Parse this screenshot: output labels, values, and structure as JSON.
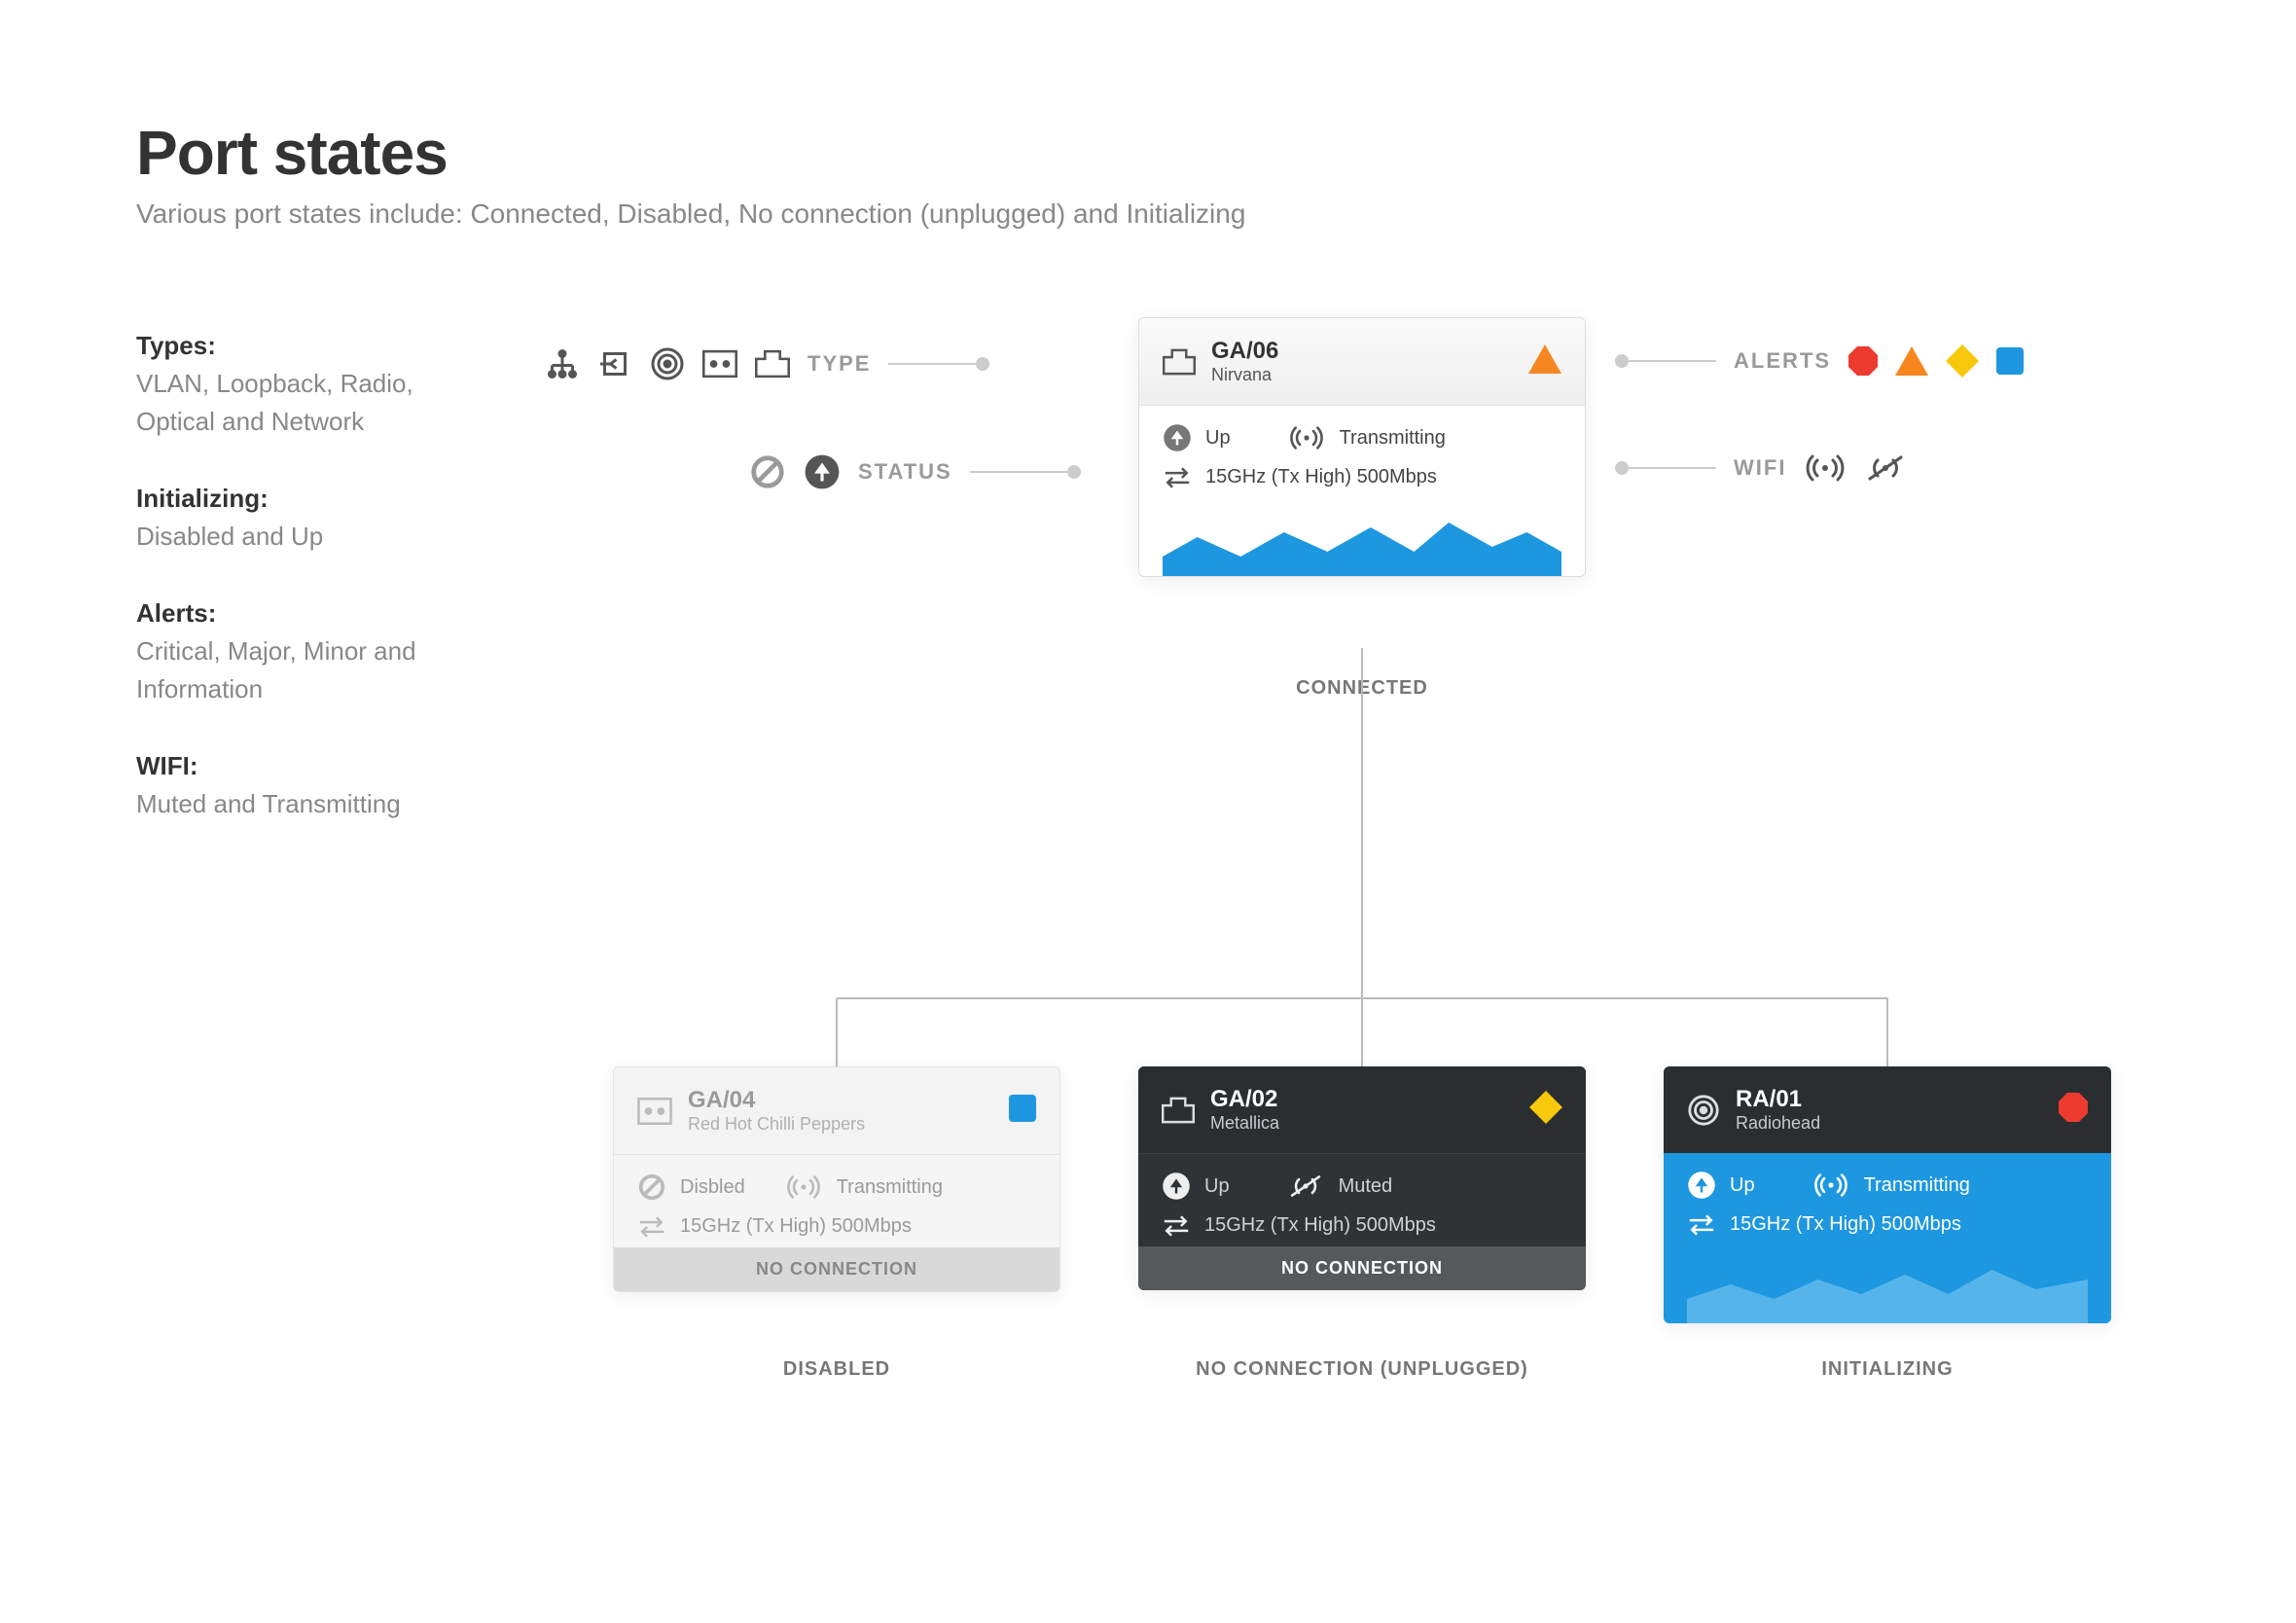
{
  "title": "Port states",
  "subtitle": "Various port states include: Connected, Disabled, No connection (unplugged) and Initializing",
  "sidebar": {
    "types_heading": "Types:",
    "types_text": "VLAN, Loopback, Radio, Optical and Network",
    "init_heading": "Initializing:",
    "init_text": "Disabled and Up",
    "alerts_heading": "Alerts:",
    "alerts_text": "Critical, Major, Minor and Information",
    "wifi_heading": "WIFI:",
    "wifi_text": "Muted and Transmitting"
  },
  "legend": {
    "type": "TYPE",
    "status": "STATUS",
    "alerts": "ALERTS",
    "wifi": "WIFI"
  },
  "cards": {
    "connected": {
      "id": "GA/06",
      "name": "Nirvana",
      "status": "Up",
      "wifi": "Transmitting",
      "stats": "15GHz (Tx High) 500Mbps",
      "caption": "CONNECTED"
    },
    "disabled": {
      "id": "GA/04",
      "name": "Red Hot Chilli Peppers",
      "status": "Disbled",
      "wifi": "Transmitting",
      "stats": "15GHz (Tx High) 500Mbps",
      "banner": "NO CONNECTION",
      "caption": "DISABLED"
    },
    "noconn": {
      "id": "GA/02",
      "name": "Metallica",
      "status": "Up",
      "wifi": "Muted",
      "stats": "15GHz (Tx High) 500Mbps",
      "banner": "NO CONNECTION",
      "caption": "NO CONNECTION (UNPLUGGED)"
    },
    "init": {
      "id": "RA/01",
      "name": "Radiohead",
      "status": "Up",
      "wifi": "Transmitting",
      "stats": "15GHz (Tx High) 500Mbps",
      "caption": "INITIALIZING"
    }
  }
}
